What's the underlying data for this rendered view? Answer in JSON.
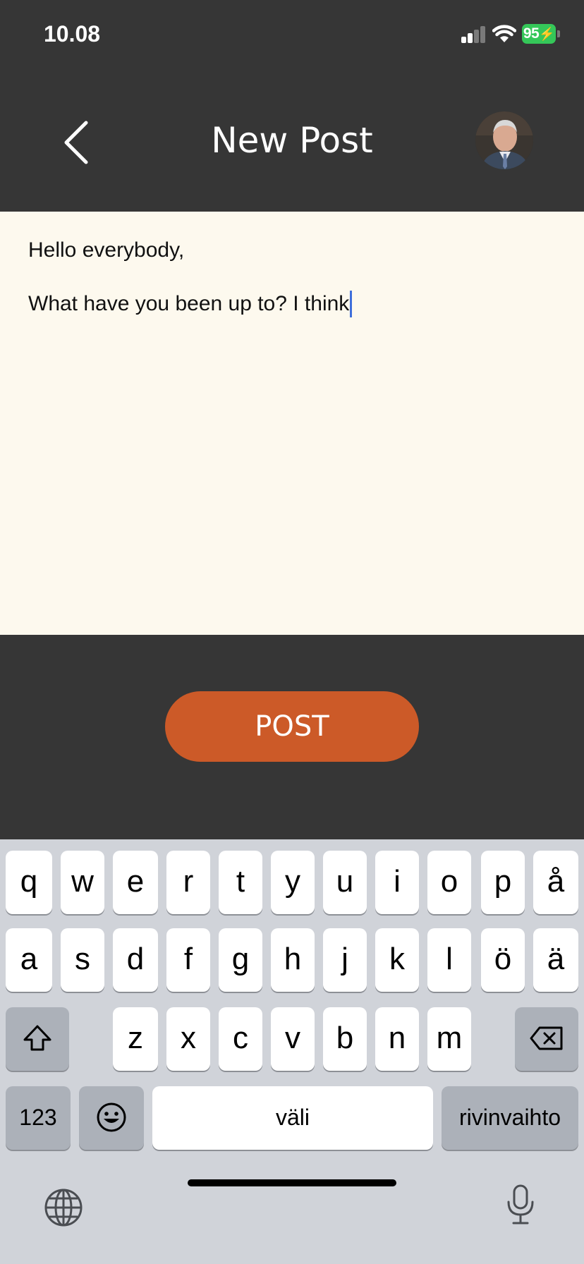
{
  "status_bar": {
    "time": "10.08",
    "battery_percent": "95",
    "battery_color": "#35c759",
    "signal_bars_active": 2,
    "signal_bars_total": 4
  },
  "nav": {
    "title": "New Post",
    "back_icon": "chevron-left-icon",
    "avatar_icon": "user-avatar"
  },
  "editor": {
    "lines": [
      "Hello everybody,",
      "What have you been up to? I think"
    ]
  },
  "post_button": {
    "label": "POST",
    "color": "#cc5a28"
  },
  "keyboard": {
    "row1": [
      "q",
      "w",
      "e",
      "r",
      "t",
      "y",
      "u",
      "i",
      "o",
      "p",
      "å"
    ],
    "row2": [
      "a",
      "s",
      "d",
      "f",
      "g",
      "h",
      "j",
      "k",
      "l",
      "ö",
      "ä"
    ],
    "row3": [
      "z",
      "x",
      "c",
      "v",
      "b",
      "n",
      "m"
    ],
    "numbers_label": "123",
    "space_label": "väli",
    "return_label": "rivinvaihto",
    "shift_icon": "shift-icon",
    "backspace_icon": "backspace-icon",
    "emoji_icon": "emoji-icon",
    "globe_icon": "globe-icon",
    "mic_icon": "microphone-icon"
  }
}
